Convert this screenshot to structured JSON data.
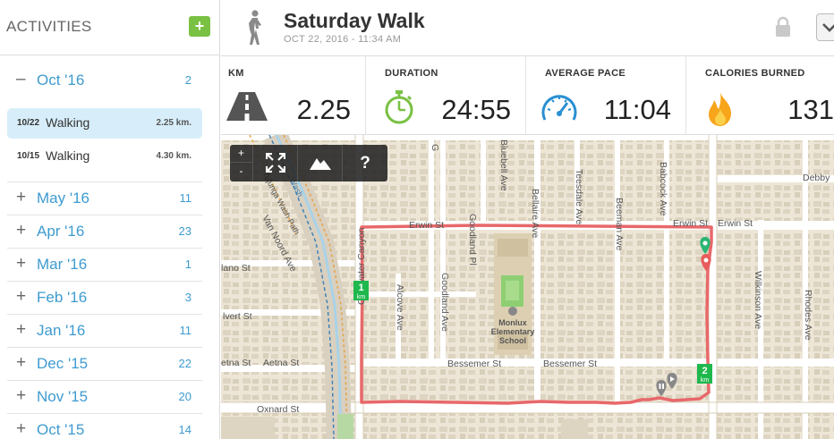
{
  "sidebar": {
    "title": "ACTIVITIES",
    "add_label": "+",
    "expanded_month": {
      "sign": "–",
      "label": "Oct '16",
      "count": "2"
    },
    "activities": [
      {
        "date": "10/22",
        "type": "Walking",
        "distance": "2.25 km.",
        "selected": true
      },
      {
        "date": "10/15",
        "type": "Walking",
        "distance": "4.30 km.",
        "selected": false
      }
    ],
    "months": [
      {
        "sign": "+",
        "label": "May '16",
        "count": "11"
      },
      {
        "sign": "+",
        "label": "Apr '16",
        "count": "23"
      },
      {
        "sign": "+",
        "label": "Mar '16",
        "count": "1"
      },
      {
        "sign": "+",
        "label": "Feb '16",
        "count": "3"
      },
      {
        "sign": "+",
        "label": "Jan '16",
        "count": "11"
      },
      {
        "sign": "+",
        "label": "Dec '15",
        "count": "22"
      },
      {
        "sign": "+",
        "label": "Nov '15",
        "count": "20"
      },
      {
        "sign": "+",
        "label": "Oct '15",
        "count": "14"
      }
    ]
  },
  "header": {
    "title": "Saturday Walk",
    "datetime": "OCT 22, 2016  -  11:34 AM",
    "activity_icon": "walker-icon",
    "lock_icon": "lock-icon",
    "menu_icon": "chevron-down-icon"
  },
  "stats": [
    {
      "label": "KM",
      "value": "2.25",
      "icon": "road-icon"
    },
    {
      "label": "DURATION",
      "value": "24:55",
      "icon": "stopwatch-icon"
    },
    {
      "label": "AVERAGE PACE",
      "value": "11:04",
      "icon": "speedometer-icon"
    },
    {
      "label": "CALORIES BURNED",
      "value": "131",
      "icon": "flame-icon"
    }
  ],
  "map": {
    "controls": {
      "zoom_in": "+",
      "zoom_out": "-",
      "fullscreen_icon": "fullscreen-icon",
      "terrain_icon": "terrain-icon",
      "help": "?"
    },
    "markers": {
      "km1": [
        "1",
        "km"
      ],
      "km2": [
        "2",
        "km"
      ]
    },
    "streets": {
      "erwin_1": "Erwin St",
      "erwin_2": "Erwin St",
      "erwin_3": "Erwin St",
      "bessemer_1": "Bessemer St",
      "bessemer_2": "Bessemer St",
      "oxnard": "Oxnard St",
      "aetna": "Aetna St",
      "aetna_2": "etna St",
      "calvert": "lvert St",
      "hano": "lano St",
      "debby": "Debby",
      "coldwater": "Coldwater Canyon",
      "goodland_1": "Goodland Pl",
      "goodland_2": "Goodland Ave",
      "bluebell": "Bluebell Ave",
      "bellaire": "Bellaire Ave",
      "teesdale": "Teesdale Ave",
      "beeman": "Beeman Ave",
      "babcock": "Babcock Ave",
      "alcove": "Alcove Ave",
      "wilkinson": "Wilkinson Ave",
      "rhodes": "Rhodes Ave",
      "van_noord": "Van Noord Ave",
      "g": "G",
      "wash_path": "Tujunga Wash Path",
      "wash": "Wash"
    },
    "school": [
      "Monlux",
      "Elementary",
      "School"
    ],
    "colors": {
      "route": "#e8686a",
      "start": "#2bb673",
      "end": "#e85c5c",
      "km_marker": "#1fb84d"
    }
  }
}
